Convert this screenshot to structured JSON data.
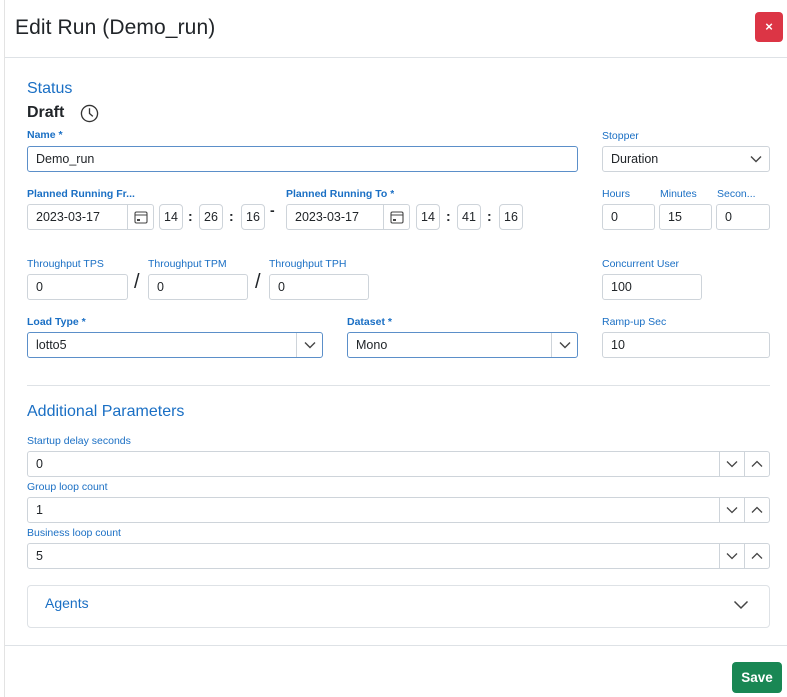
{
  "header": {
    "title": "Edit Run (Demo_run)",
    "close_label": "×"
  },
  "status": {
    "section_title": "Status",
    "value": "Draft"
  },
  "name": {
    "label": "Name *",
    "value": "Demo_run"
  },
  "stopper": {
    "label": "Stopper",
    "value": "Duration"
  },
  "planned_from": {
    "label": "Planned Running Fr...",
    "date": "2023-03-17",
    "hh": "14",
    "mm": "26",
    "ss": "16"
  },
  "range_sep": "-",
  "planned_to": {
    "label": "Planned Running To *",
    "date": "2023-03-17",
    "hh": "14",
    "mm": "41",
    "ss": "16"
  },
  "time_sep": ":",
  "duration": {
    "hours_label": "Hours",
    "hours": "0",
    "minutes_label": "Minutes",
    "minutes": "15",
    "seconds_label": "Secon...",
    "seconds": "0"
  },
  "throughput": {
    "tps_label": "Throughput TPS",
    "tps": "0",
    "tpm_label": "Throughput TPM",
    "tpm": "0",
    "tph_label": "Throughput TPH",
    "tph": "0",
    "slash": "/"
  },
  "concurrent": {
    "label": "Concurrent User",
    "value": "100"
  },
  "load_type": {
    "label": "Load Type *",
    "value": "lotto5"
  },
  "dataset": {
    "label": "Dataset *",
    "value": "Mono"
  },
  "rampup": {
    "label": "Ramp-up Sec",
    "value": "10"
  },
  "additional": {
    "title": "Additional Parameters",
    "startup_label": "Startup delay seconds",
    "startup": "0",
    "group_label": "Group loop count",
    "group": "1",
    "business_label": "Business loop count",
    "business": "5"
  },
  "agents": {
    "label": "Agents"
  },
  "footer": {
    "save_label": "Save"
  },
  "colors": {
    "accent": "#1a6fc4",
    "danger": "#dc3545",
    "success": "#198754"
  }
}
